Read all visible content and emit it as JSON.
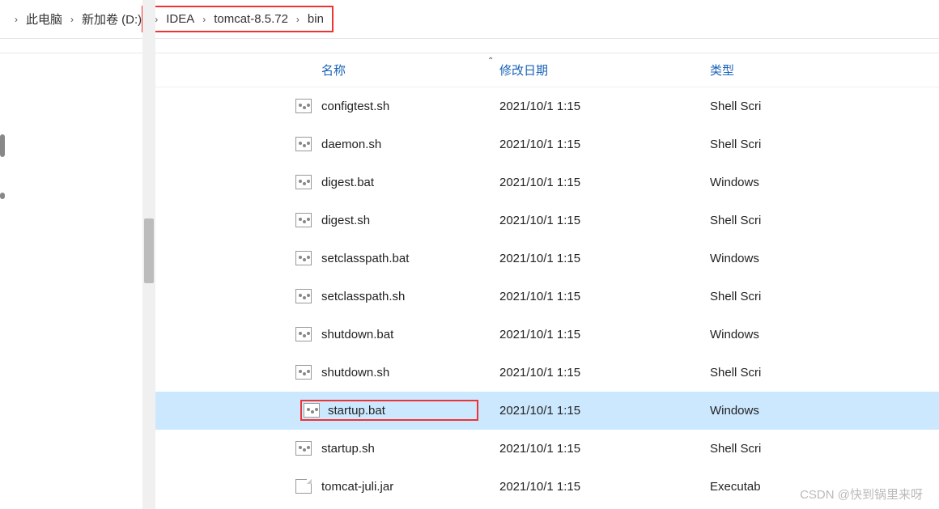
{
  "breadcrumb": {
    "items": [
      "此电脑",
      "新加卷 (D:)",
      "IDEA",
      "tomcat-8.5.72",
      "bin"
    ]
  },
  "columns": {
    "name": "名称",
    "date": "修改日期",
    "type": "类型"
  },
  "files": [
    {
      "name": "configtest.sh",
      "date": "2021/10/1 1:15",
      "type": "Shell Scri",
      "icon": "script",
      "selected": false,
      "hl": false
    },
    {
      "name": "daemon.sh",
      "date": "2021/10/1 1:15",
      "type": "Shell Scri",
      "icon": "script",
      "selected": false,
      "hl": false
    },
    {
      "name": "digest.bat",
      "date": "2021/10/1 1:15",
      "type": "Windows",
      "icon": "script",
      "selected": false,
      "hl": false
    },
    {
      "name": "digest.sh",
      "date": "2021/10/1 1:15",
      "type": "Shell Scri",
      "icon": "script",
      "selected": false,
      "hl": false
    },
    {
      "name": "setclasspath.bat",
      "date": "2021/10/1 1:15",
      "type": "Windows",
      "icon": "script",
      "selected": false,
      "hl": false
    },
    {
      "name": "setclasspath.sh",
      "date": "2021/10/1 1:15",
      "type": "Shell Scri",
      "icon": "script",
      "selected": false,
      "hl": false
    },
    {
      "name": "shutdown.bat",
      "date": "2021/10/1 1:15",
      "type": "Windows",
      "icon": "script",
      "selected": false,
      "hl": false
    },
    {
      "name": "shutdown.sh",
      "date": "2021/10/1 1:15",
      "type": "Shell Scri",
      "icon": "script",
      "selected": false,
      "hl": false
    },
    {
      "name": "startup.bat",
      "date": "2021/10/1 1:15",
      "type": "Windows",
      "icon": "script",
      "selected": true,
      "hl": true
    },
    {
      "name": "startup.sh",
      "date": "2021/10/1 1:15",
      "type": "Shell Scri",
      "icon": "script",
      "selected": false,
      "hl": false
    },
    {
      "name": "tomcat-juli.jar",
      "date": "2021/10/1 1:15",
      "type": "Executab",
      "icon": "jar",
      "selected": false,
      "hl": false
    }
  ],
  "watermark": "CSDN @快到锅里来呀"
}
